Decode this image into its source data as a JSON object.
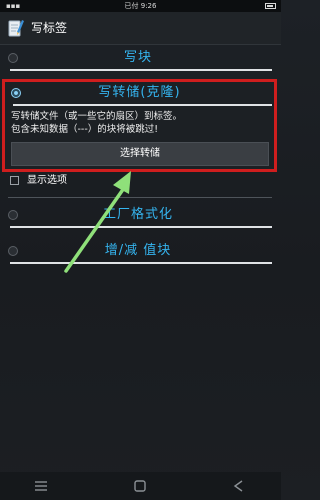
{
  "status_bar": {
    "carrier": "已付",
    "time": "9:26"
  },
  "app": {
    "title": "写标签",
    "icon": "notepad-pencil-icon"
  },
  "options": [
    {
      "label": "写块",
      "checked": false
    },
    {
      "label": "写转储(克隆)",
      "checked": true
    },
    {
      "label": "工厂格式化",
      "checked": false
    },
    {
      "label": "增/减 值块",
      "checked": false
    }
  ],
  "clone": {
    "description_line1": "写转储文件（或一些它的扇区）到标签。",
    "description_line2": "包含未知数据（---）的块将被跳过!",
    "select_button": "选择转储"
  },
  "show_options": {
    "label": "显示选项",
    "checked": false
  },
  "colors": {
    "accent": "#35b4ef",
    "highlight_border": "#cf1e1e",
    "arrow": "#8fe07a"
  }
}
